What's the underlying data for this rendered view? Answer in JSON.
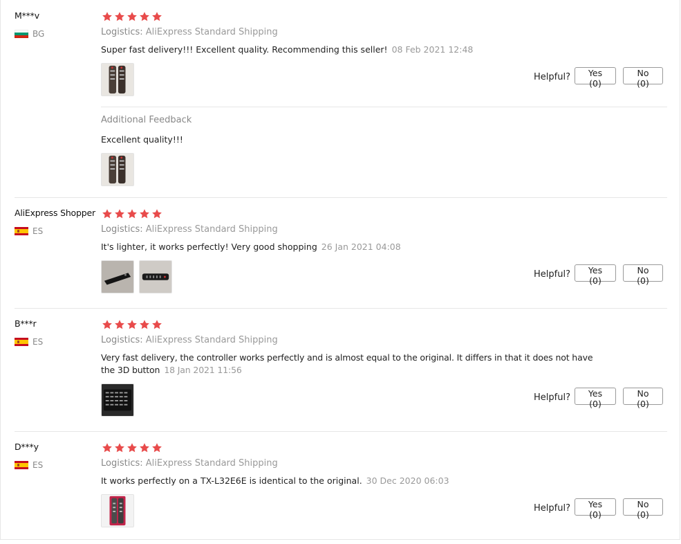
{
  "helpful_label": "Helpful?",
  "additional_feedback_title": "Additional Feedback",
  "star_color": "#e84b4b",
  "reviews": [
    {
      "user": "M***v",
      "country": "BG",
      "rating": 5,
      "logistics_label": "Logistics:",
      "logistics_value": "AliExpress Standard Shipping",
      "text": "Super fast delivery!!! Excellent quality. Recommending this seller!",
      "date": "08 Feb 2021 12:48",
      "yes": "Yes (0)",
      "no": "No (0)",
      "additional_text": "Excellent quality!!!"
    },
    {
      "user": "AliExpress Shopper",
      "country": "ES",
      "rating": 5,
      "logistics_label": "Logistics:",
      "logistics_value": "AliExpress Standard Shipping",
      "text": "It's lighter, it works perfectly! Very good shopping",
      "date": "26 Jan 2021 04:08",
      "yes": "Yes (0)",
      "no": "No (0)"
    },
    {
      "user": "B***r",
      "country": "ES",
      "rating": 5,
      "logistics_label": "Logistics:",
      "logistics_value": "AliExpress Standard Shipping",
      "text_line1": "Very fast delivery, the controller works perfectly and is almost equal to the original. It differs in that it does not have",
      "text_line2": "the 3D button",
      "date": "18 Jan 2021 11:56",
      "yes": "Yes (0)",
      "no": "No (0)"
    },
    {
      "user": "D***y",
      "country": "ES",
      "rating": 5,
      "logistics_label": "Logistics:",
      "logistics_value": "AliExpress Standard Shipping",
      "text": "It works perfectly on a TX-L32E6E is identical to the original.",
      "date": "30 Dec 2020 06:03",
      "yes": "Yes (0)",
      "no": "No (0)"
    }
  ]
}
